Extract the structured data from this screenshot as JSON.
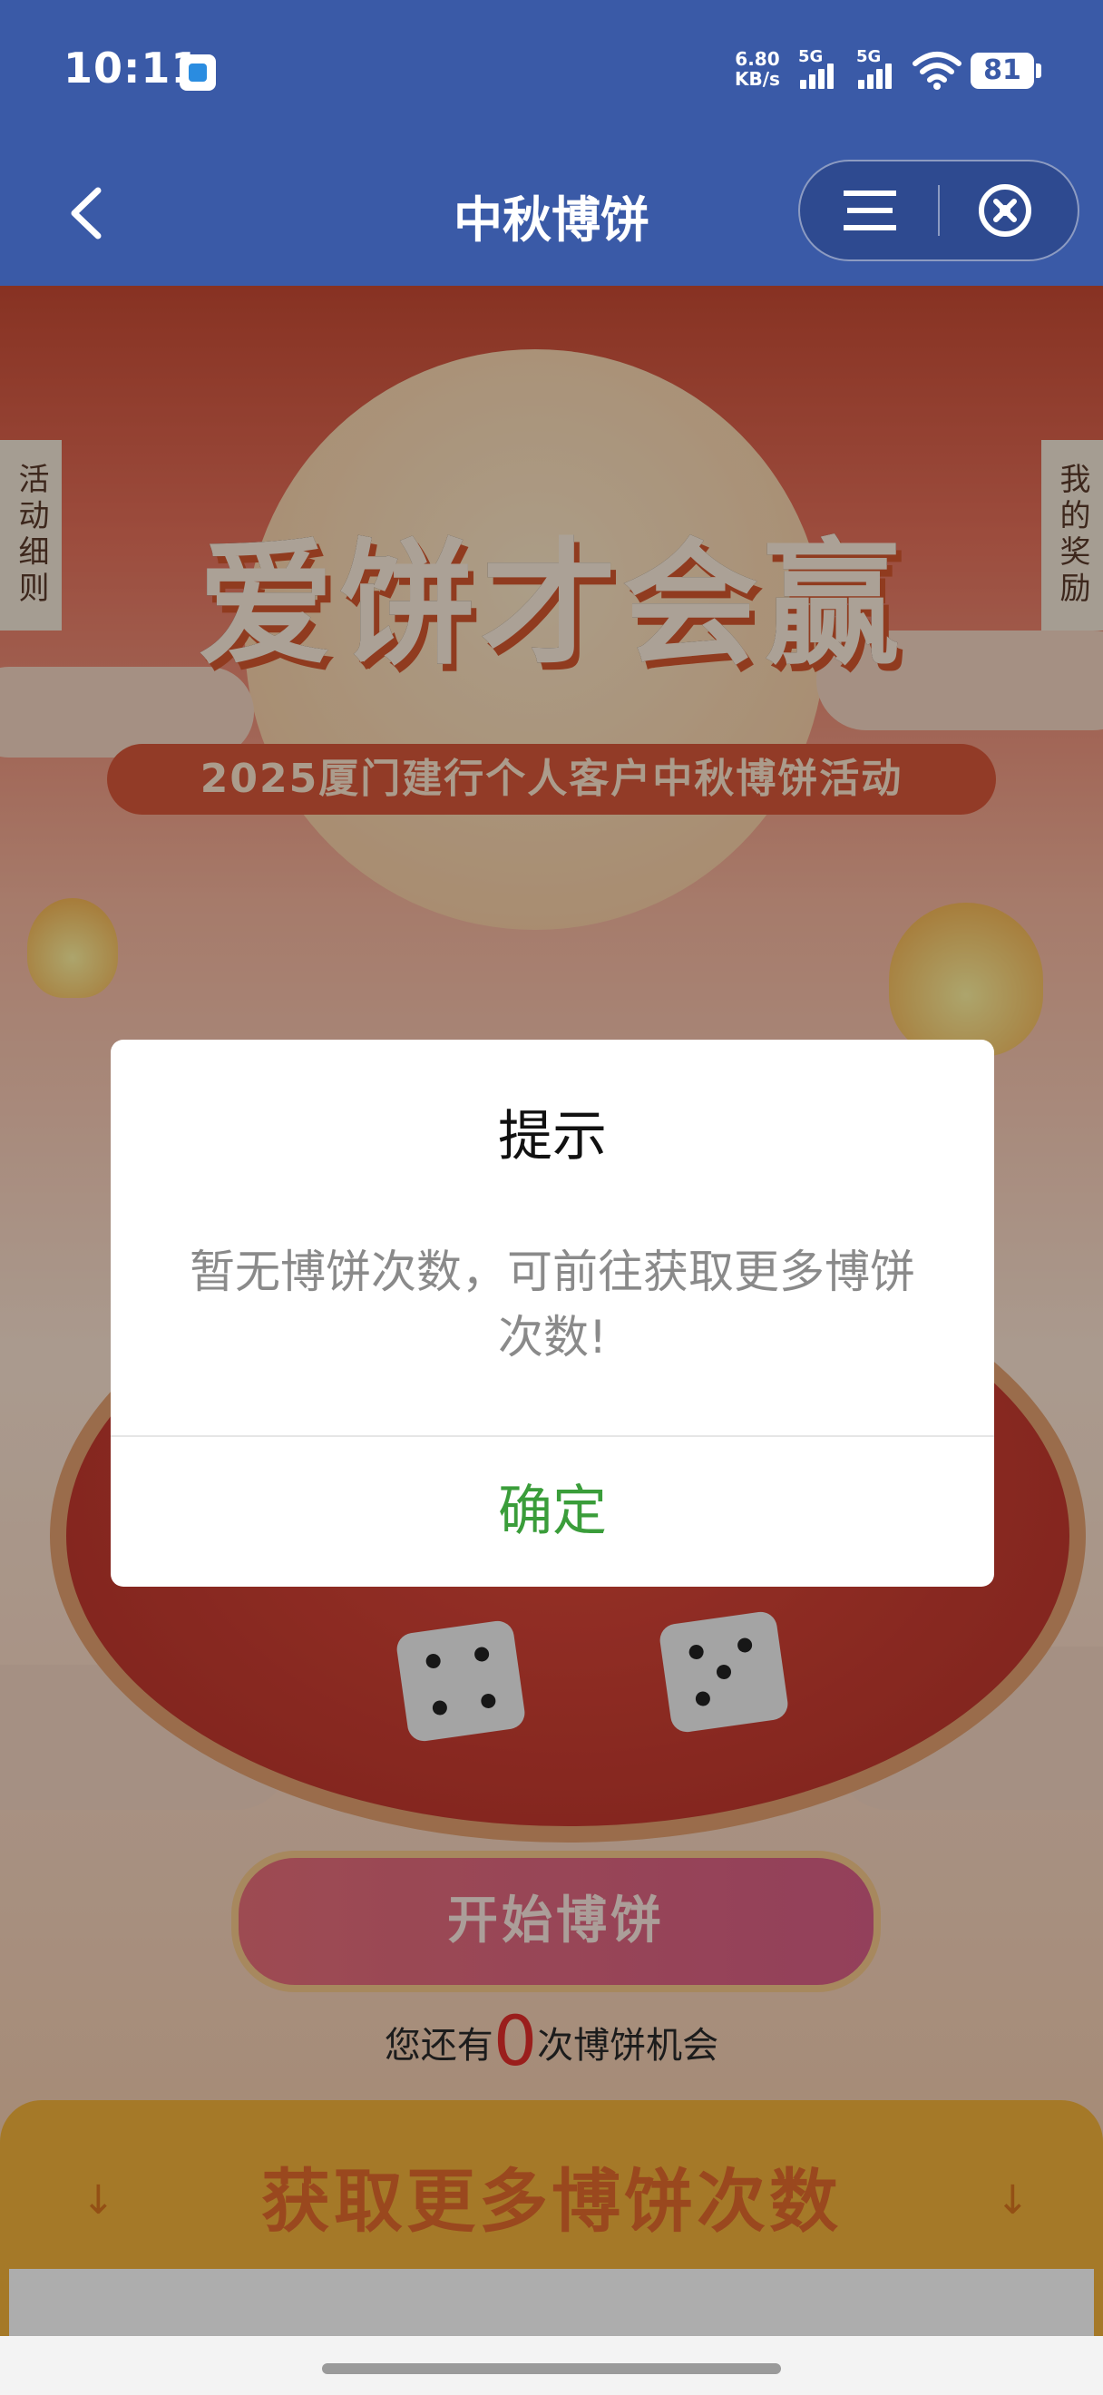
{
  "status_bar": {
    "time": "10:11",
    "net_speed_value": "6.80",
    "net_speed_unit": "KB/s",
    "signal1_label": "5G",
    "signal2_label": "5G",
    "battery": "81"
  },
  "nav": {
    "title": "中秋博饼"
  },
  "banner": {
    "left_tab": "活动细则",
    "right_tab": "我的奖励",
    "headline": "爱饼才会赢",
    "subtitle": "2025厦门建行个人客户中秋博饼活动"
  },
  "game": {
    "start_button": "开始博饼",
    "remaining_prefix": "您还有",
    "remaining_count": "0",
    "remaining_suffix": "次博饼机会"
  },
  "more": {
    "title": "获取更多博饼次数",
    "arrow_left": "↓",
    "arrow_right": "↓"
  },
  "dialog": {
    "title": "提示",
    "message": "暂无博饼次数，可前往获取更多博饼次数!",
    "confirm": "确定"
  },
  "colors": {
    "nav_bg": "#3a5aa7",
    "confirm_text": "#3a9d3a",
    "count_red": "#e42d2a"
  }
}
